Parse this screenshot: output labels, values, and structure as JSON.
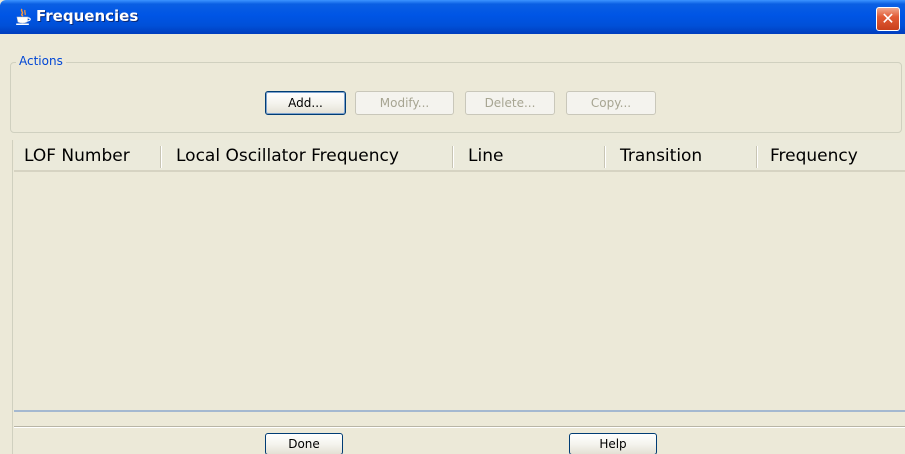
{
  "window": {
    "title": "Frequencies",
    "close_glyph": "✕"
  },
  "actions": {
    "legend": "Actions",
    "buttons": [
      {
        "label": "Add...",
        "enabled": true
      },
      {
        "label": "Modify...",
        "enabled": false
      },
      {
        "label": "Delete...",
        "enabled": false
      },
      {
        "label": "Copy...",
        "enabled": false
      }
    ]
  },
  "table": {
    "columns": [
      "LOF Number",
      "Local Oscillator Frequency",
      "Line",
      "Transition",
      "Frequency"
    ],
    "rows": []
  },
  "footer": {
    "done_label": "Done",
    "help_label": "Help"
  },
  "colors": {
    "titlebar": "#0055e5",
    "window_bg": "#ece9d8",
    "close_button": "#e25c36",
    "legend_text": "#0046d5"
  }
}
